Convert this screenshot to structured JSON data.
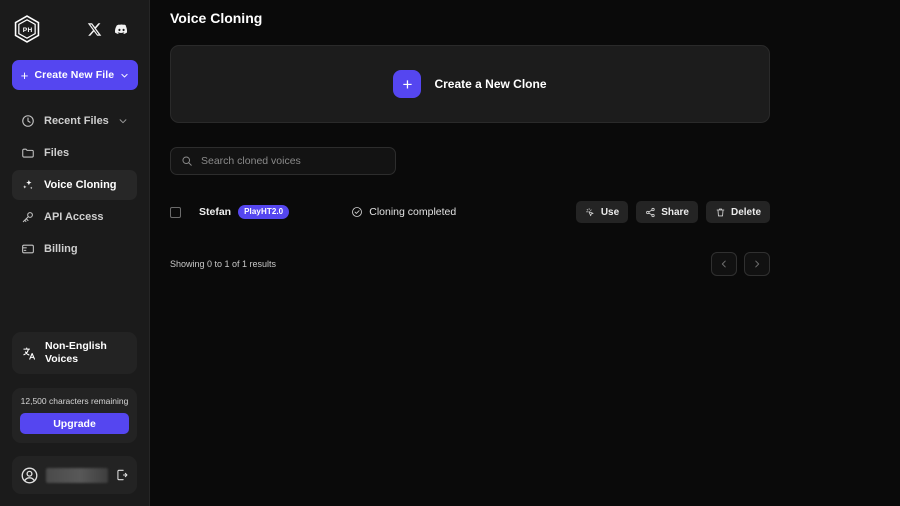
{
  "colors": {
    "accent": "#5546f0",
    "sidebar_bg": "#1b1b1b",
    "main_bg": "#0a0a0a",
    "card_bg": "#1c1c1c",
    "badge_bg": "#5546f0"
  },
  "sidebar": {
    "logo_name": "playht-cube-logo",
    "socials": [
      {
        "name": "x-twitter-icon",
        "label": "X"
      },
      {
        "name": "discord-icon",
        "label": "Discord"
      }
    ],
    "create_button": {
      "label": "Create New File",
      "plus": "+"
    },
    "items": [
      {
        "label": "Recent Files",
        "icon": "clock-icon",
        "active": false,
        "has_chevron": true
      },
      {
        "label": "Files",
        "icon": "folder-icon",
        "active": false,
        "has_chevron": false
      },
      {
        "label": "Voice Cloning",
        "icon": "sparkles-icon",
        "active": true,
        "has_chevron": false
      },
      {
        "label": "API Access",
        "icon": "key-icon",
        "active": false,
        "has_chevron": false
      },
      {
        "label": "Billing",
        "icon": "credit-card-icon",
        "active": false,
        "has_chevron": false
      }
    ],
    "non_english": {
      "label": "Non-English Voices",
      "icon": "translate-icon"
    },
    "quota": {
      "text": "12,500 characters remaining",
      "upgrade_label": "Upgrade"
    },
    "account": {
      "username": "",
      "avatar_icon": "user-circle-icon",
      "logout_icon": "logout-icon"
    }
  },
  "main": {
    "page_title": "Voice Cloning",
    "create_clone": {
      "label": "Create a New Clone",
      "plus": "+"
    },
    "search": {
      "value": "",
      "placeholder": "Search cloned voices"
    },
    "voices": [
      {
        "name": "Stefan",
        "badge": "PlayHT2.0",
        "status": "Cloning completed",
        "status_icon": "check-circle-icon",
        "checked": false,
        "actions": [
          {
            "label": "Use",
            "icon": "cursor-click-icon"
          },
          {
            "label": "Share",
            "icon": "share-icon"
          },
          {
            "label": "Delete",
            "icon": "trash-icon"
          }
        ]
      }
    ],
    "pagination": {
      "showing": "Showing 0 to 1 of 1 results",
      "prev_icon": "chevron-left-icon",
      "next_icon": "chevron-right-icon"
    }
  }
}
